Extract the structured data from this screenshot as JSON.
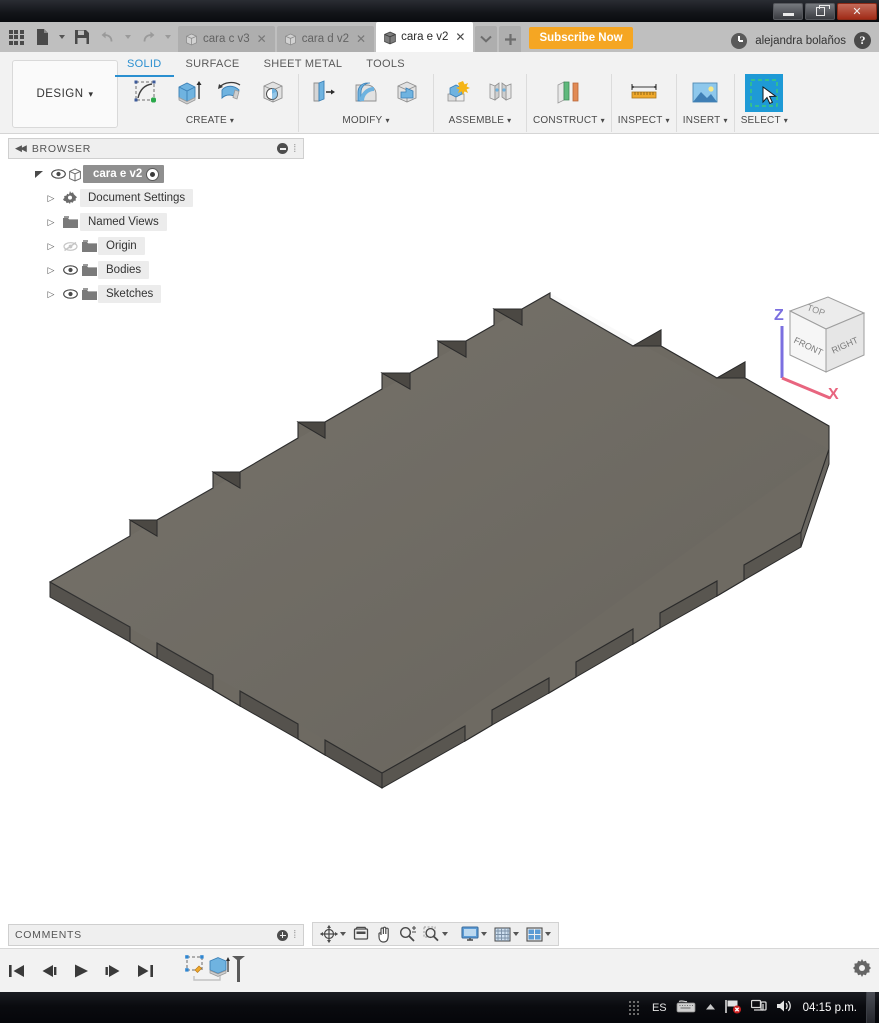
{
  "window": {
    "buttons": {
      "minimize": "minimize-icon",
      "restore": "restore-icon",
      "close": "✕"
    }
  },
  "topbar": {
    "app_grid": "app-grid-icon",
    "file_label": "file-icon",
    "save_label": "save-icon",
    "undo_label": "undo-icon",
    "redo_label": "redo-icon",
    "tabs": [
      {
        "title": "cara c v3",
        "active": false,
        "close": "✕"
      },
      {
        "title": "cara d v2",
        "active": false,
        "close": "✕"
      },
      {
        "title": "cara e v2",
        "active": true,
        "close": "✕"
      }
    ],
    "tab_overflow": "chevron-down-icon",
    "new_tab": "+",
    "subscribe_label": "Subscribe Now",
    "job_status": "clock-icon",
    "user_name": "alejandra bolaños",
    "help": "?"
  },
  "ribbon": {
    "workspace_label": "DESIGN",
    "workspace_caret": "▾",
    "tabs": [
      {
        "label": "SOLID",
        "selected": true
      },
      {
        "label": "SURFACE",
        "selected": false
      },
      {
        "label": "SHEET METAL",
        "selected": false
      },
      {
        "label": "TOOLS",
        "selected": false
      }
    ],
    "panels": [
      {
        "label": "CREATE",
        "caret": "▾",
        "icons": [
          "create-sketch-icon",
          "extrude-icon",
          "revolve-icon",
          "sweep-icon"
        ]
      },
      {
        "label": "MODIFY",
        "caret": "▾",
        "icons": [
          "press-pull-icon",
          "fillet-icon",
          "shell-icon"
        ]
      },
      {
        "label": "ASSEMBLE",
        "caret": "▾",
        "icons": [
          "new-component-icon",
          "joint-icon"
        ]
      },
      {
        "label": "CONSTRUCT",
        "caret": "▾",
        "icons": [
          "offset-plane-icon"
        ]
      },
      {
        "label": "INSPECT",
        "caret": "▾",
        "icons": [
          "measure-icon"
        ]
      },
      {
        "label": "INSERT",
        "caret": "▾",
        "icons": [
          "insert-image-icon"
        ]
      },
      {
        "label": "SELECT",
        "caret": "▾",
        "icons": [
          "select-window-icon"
        ]
      }
    ]
  },
  "browser": {
    "title": "BROWSER",
    "collapse_icon": "collapse-left-icon",
    "minimize_icon": "minimize-panel-icon",
    "root": {
      "label": "cara e v2",
      "icon": "component-icon",
      "eye": "visible-eye-icon",
      "radio": "activate-radio-icon"
    },
    "items": [
      {
        "label": "Document Settings",
        "icon": "gear-icon",
        "eye": null,
        "expand": "▷"
      },
      {
        "label": "Named Views",
        "icon": "folder-icon",
        "eye": null,
        "expand": "▷"
      },
      {
        "label": "Origin",
        "icon": "folder-icon",
        "eye": "hidden-eye-icon",
        "expand": "▷"
      },
      {
        "label": "Bodies",
        "icon": "folder-icon",
        "eye": "visible-eye-icon",
        "expand": "▷"
      },
      {
        "label": "Sketches",
        "icon": "folder-icon",
        "eye": "visible-eye-icon",
        "expand": "▷"
      }
    ]
  },
  "viewcube": {
    "faces": {
      "top": "TOP",
      "front": "FRONT",
      "right": "RIGHT"
    },
    "axes": {
      "z": "Z",
      "x": "X"
    },
    "z_color": "#7b6fe0",
    "x_color": "#e8657f"
  },
  "model": {
    "name": "notched-plate-body",
    "top_face_color": "#6e6a62",
    "side_light_color": "#8b8780",
    "side_dark_color": "#4e4b46",
    "edge_color": "#2b2b2b"
  },
  "comments": {
    "title": "COMMENTS",
    "add_icon": "add-comment-icon"
  },
  "navbar": {
    "items": [
      {
        "name": "orbit-icon",
        "caret": "▾"
      },
      {
        "name": "look-at-icon",
        "caret": null
      },
      {
        "name": "pan-icon",
        "caret": null
      },
      {
        "name": "zoom-icon",
        "caret": null
      },
      {
        "name": "zoom-window-icon",
        "caret": "▾"
      },
      {
        "name": "display-settings-icon",
        "caret": "▾"
      },
      {
        "name": "grid-snap-icon",
        "caret": "▾"
      },
      {
        "name": "viewports-icon",
        "caret": "▾"
      }
    ]
  },
  "timeline": {
    "controls": [
      {
        "name": "go-to-beginning-icon",
        "glyph": "first"
      },
      {
        "name": "step-back-icon",
        "glyph": "prev"
      },
      {
        "name": "play-icon",
        "glyph": "play"
      },
      {
        "name": "step-forward-icon",
        "glyph": "next"
      },
      {
        "name": "go-to-end-icon",
        "glyph": "last"
      }
    ],
    "features": [
      {
        "name": "sketch-feature-icon"
      },
      {
        "name": "extrude-feature-icon"
      }
    ],
    "settings_icon": "gear-icon"
  },
  "taskbar": {
    "language": "ES",
    "keyboard_icon": "keyboard-icon",
    "show_hidden_icon": "show-hidden-icons-icon",
    "flag_icon": "action-center-flag-icon",
    "network_icon": "network-icon",
    "volume_icon": "volume-icon",
    "clock": "04:15 p.m."
  }
}
